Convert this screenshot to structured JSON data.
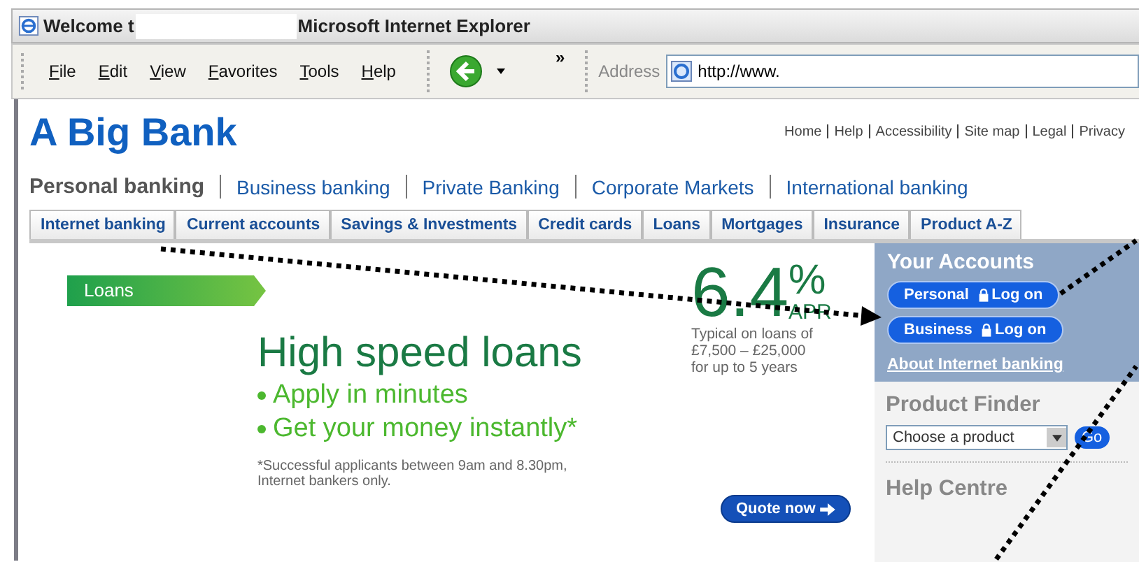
{
  "window": {
    "title_start": "Welcome t",
    "title_end": "Microsoft Internet Explorer"
  },
  "menu": [
    "File",
    "Edit",
    "View",
    "Favorites",
    "Tools",
    "Help"
  ],
  "toolbar": {
    "chevron": "»",
    "address_label": "Address",
    "address": "http://www."
  },
  "site": {
    "logo": "A Big Bank",
    "utility_links": [
      "Home",
      "Help",
      "Accessibility",
      "Site map",
      "Legal",
      "Privacy"
    ],
    "sections": [
      {
        "label": "Personal banking",
        "selected": true
      },
      {
        "label": "Business banking",
        "selected": false
      },
      {
        "label": "Private Banking",
        "selected": false
      },
      {
        "label": "Corporate Markets",
        "selected": false
      },
      {
        "label": "International banking",
        "selected": false
      }
    ],
    "tabs": [
      "Internet banking",
      "Current accounts",
      "Savings & Investments",
      "Credit cards",
      "Loans",
      "Mortgages",
      "Insurance",
      "Product A-Z"
    ]
  },
  "banner": {
    "tag": "Loans",
    "headline": "High speed loans",
    "bullets": [
      "Apply in minutes",
      "Get your money instantly*"
    ],
    "footnote": "*Successful applicants between 9am and 8.30pm,\nInternet bankers only.",
    "rate": "6.4",
    "rate_unit": "%",
    "rate_label": "APR",
    "rate_note": "Typical on loans of\n£7,500 – £25,000\nfor up to 5 years",
    "cta": "Quote now"
  },
  "sidebar": {
    "accounts_title": "Your Accounts",
    "logons": [
      {
        "label": "Personal",
        "action": "Log on"
      },
      {
        "label": "Business",
        "action": "Log on"
      }
    ],
    "about_link": "About Internet banking",
    "finder_title": "Product Finder",
    "finder_placeholder": "Choose a product",
    "go": "Go",
    "help_title": "Help Centre"
  }
}
